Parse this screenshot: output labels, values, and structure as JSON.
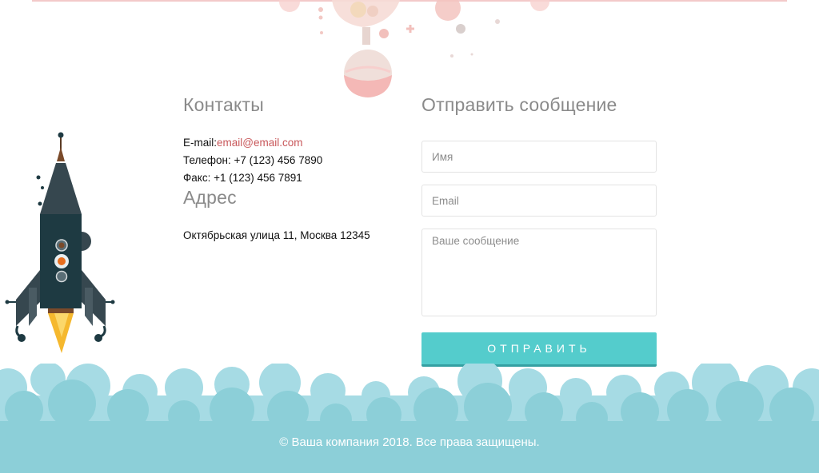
{
  "contacts": {
    "title": "Контакты",
    "email_label": "E-mail:",
    "email_value": "email@email.com",
    "phone": "Телефон: +7 (123) 456 7890",
    "fax": "Факс: +1 (123) 456 7891"
  },
  "address": {
    "title": "Адрес",
    "text": "Октябрьская улица 11, Москва 12345"
  },
  "form": {
    "title": "Отправить сообщение",
    "name_placeholder": "Имя",
    "email_placeholder": "Email",
    "message_placeholder": "Ваше сообщение",
    "submit_label": "ОТПРАВИТЬ"
  },
  "footer": {
    "copyright": "© Ваша компания 2018. Все права защищены."
  },
  "colors": {
    "accent": "#54cccc",
    "link": "#c8575a",
    "cloud_light": "#a6dbe4",
    "cloud_dark": "#8ccfd8",
    "rocket_body": "#1e3a42",
    "rocket_flame": "#f5b82e"
  }
}
